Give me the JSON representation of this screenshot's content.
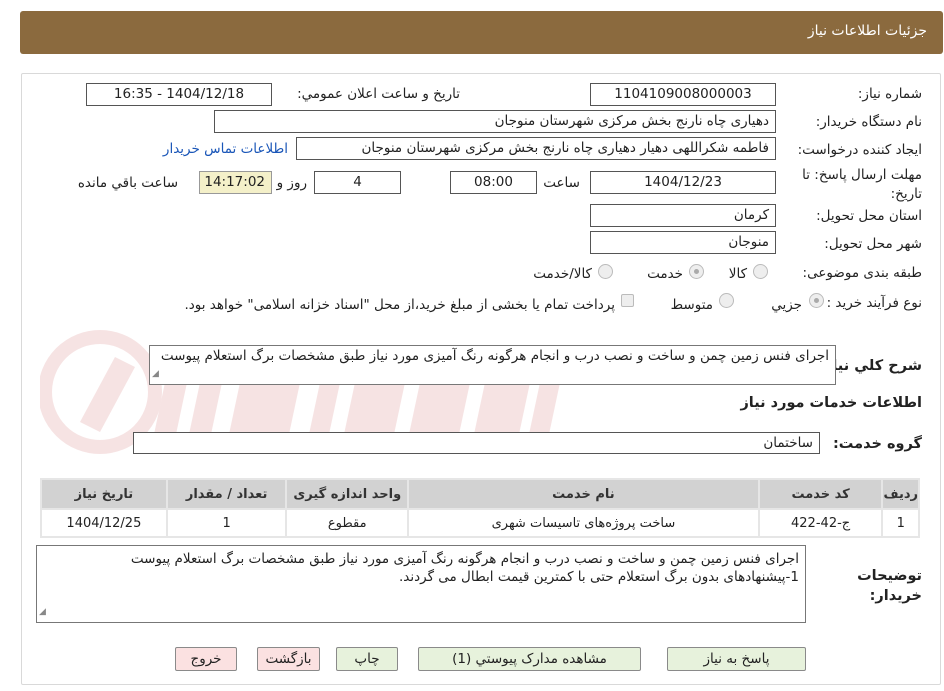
{
  "header": {
    "title": "جزئیات اطلاعات نیاز"
  },
  "form": {
    "need_number_label": "شماره نیاز:",
    "need_number": "1104109008000003",
    "announce_label": "تاریخ و ساعت اعلان عمومي:",
    "announce_value": "1404/12/18 - 16:35",
    "buyer_label": "نام دستگاه خريدار:",
    "buyer_value": "دهیاری چاه نارنج بخش مرکزی شهرستان منوجان",
    "requester_label": "ايجاد کننده درخواست:",
    "requester_value": "فاطمه شکراللهی دهیار دهیاری چاه نارنج بخش مرکزی شهرستان منوجان",
    "contact_link": "اطلاعات تماس خريدار",
    "deadline_label": "مهلت ارسال پاسخ: تا تاريخ:",
    "deadline_date": "1404/12/23",
    "hour_label": "ساعت",
    "deadline_time": "08:00",
    "days_value": "4",
    "days_label": "روز و",
    "remaining_time": "14:17:02",
    "remaining_label": "ساعت باقي مانده",
    "province_label": "استان محل تحويل:",
    "province_value": "کرمان",
    "city_label": "شهر محل تحويل:",
    "city_value": "منوجان",
    "category_label": "طبقه بندی موضوعی:",
    "category_options": [
      "کالا",
      "خدمت",
      "کالا/خدمت"
    ],
    "process_label": "نوع فرآيند خريد :",
    "process_options": [
      "جزيي",
      "متوسط"
    ],
    "payment_note": "پرداخت تمام یا بخشی از مبلغ خرید،از محل \"اسناد خزانه اسلامی\" خواهد بود.",
    "summary_label": "شرح کلي نياز:",
    "summary_value": "اجرای فنس زمین چمن و ساخت و نصب درب و انجام هرگونه رنگ آمیزی مورد نیاز طبق مشخصات برگ استعلام پیوست",
    "services_heading": "اطلاعات خدمات مورد نياز",
    "service_group_label": "گروه خدمت:",
    "service_group_value": "ساختمان"
  },
  "table": {
    "headers": [
      "رديف",
      "کد خدمت",
      "نام خدمت",
      "واحد اندازه گيری",
      "تعداد / مقدار",
      "تاريخ نياز"
    ],
    "rows": [
      [
        "1",
        "ج-42-422",
        "ساخت پروژه‌های تاسیسات شهری",
        "مقطوع",
        "1",
        "1404/12/25"
      ]
    ]
  },
  "notes": {
    "label": "توضيحات خريدار:",
    "line1": "اجرای فنس زمین چمن و ساخت و نصب درب و انجام هرگونه رنگ آمیزی مورد نیاز طبق مشخصات برگ استعلام پیوست",
    "line2": "1-پیشنهادهای بدون برگ استعلام حتی با کمترین قیمت ابطال می گردند."
  },
  "buttons": {
    "reply": "پاسخ به نياز",
    "attachments": "مشاهده مدارک پيوستي (1)",
    "print": "چاپ",
    "back": "بازگشت",
    "exit": "خروج"
  },
  "colors": {
    "header": "#8b6a3e",
    "link": "#1a56b8",
    "green_button": "#e7f2dc",
    "pink_button": "#fbe1e1"
  }
}
